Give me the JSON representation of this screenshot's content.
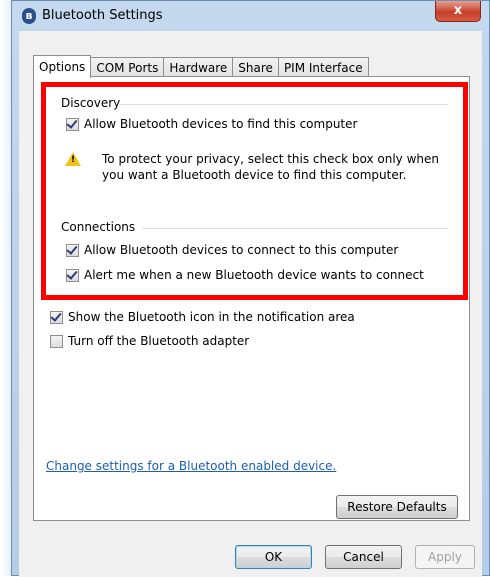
{
  "window": {
    "title": "Bluetooth Settings",
    "close_glyph": "x",
    "title_icon": "bluetooth-icon"
  },
  "tabs": [
    {
      "label": "Options",
      "active": true
    },
    {
      "label": "COM Ports",
      "active": false
    },
    {
      "label": "Hardware",
      "active": false
    },
    {
      "label": "Share",
      "active": false
    },
    {
      "label": "PIM Interface",
      "active": false
    }
  ],
  "discovery": {
    "heading": "Discovery",
    "allow_find": {
      "label": "Allow Bluetooth devices to find this computer",
      "checked": true
    },
    "warning_icon": "warning-icon",
    "warning_line1": "To protect your privacy, select this check box only when",
    "warning_line2": "you want a Bluetooth device to find this computer."
  },
  "connections": {
    "heading": "Connections",
    "allow_connect": {
      "label": "Allow Bluetooth devices to connect to this computer",
      "checked": true
    },
    "alert_new": {
      "label": "Alert me when a new Bluetooth device wants to connect",
      "checked": true
    }
  },
  "general": {
    "show_icon": {
      "label": "Show the Bluetooth icon in the notification area",
      "checked": true
    },
    "turn_off": {
      "label": "Turn off the Bluetooth adapter",
      "checked": false
    }
  },
  "link_text": "Change settings for a Bluetooth enabled device.",
  "buttons": {
    "restore": "Restore Defaults",
    "ok": "OK",
    "cancel": "Cancel",
    "apply": "Apply"
  },
  "colors": {
    "highlight_box": "#ff0000",
    "link": "#1a5fb4"
  }
}
